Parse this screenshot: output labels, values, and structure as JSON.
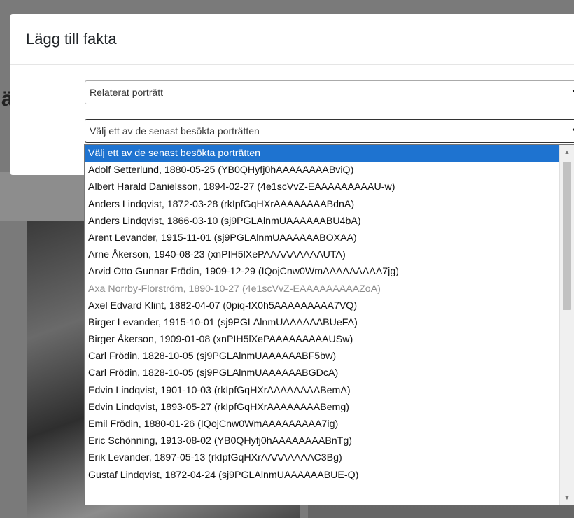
{
  "page": {
    "heading_fragment": "ä"
  },
  "modal": {
    "title": "Lägg till fakta",
    "type_select": {
      "value": "Relaterat porträtt"
    },
    "portrait_select": {
      "value": "Välj ett av de senast besökta porträtten"
    }
  },
  "dropdown": {
    "options": [
      {
        "label": "Välj ett av de senast besökta porträtten",
        "state": "selected"
      },
      {
        "label": "Adolf Setterlund, 1880-05-25 (YB0QHyfj0hAAAAAAAABviQ)",
        "state": "normal"
      },
      {
        "label": "Albert Harald Danielsson, 1894-02-27 (4e1scVvZ-EAAAAAAAAAU-w)",
        "state": "normal"
      },
      {
        "label": "Anders Lindqvist, 1872-03-28 (rkIpfGqHXrAAAAAAAABdnA)",
        "state": "normal"
      },
      {
        "label": "Anders Lindqvist, 1866-03-10 (sj9PGLAlnmUAAAAAABU4bA)",
        "state": "normal"
      },
      {
        "label": "Arent Levander, 1915-11-01 (sj9PGLAlnmUAAAAAABOXAA)",
        "state": "normal"
      },
      {
        "label": "Arne Åkerson, 1940-08-23 (xnPIH5lXePAAAAAAAAAUTA)",
        "state": "normal"
      },
      {
        "label": "Arvid Otto Gunnar Frödin, 1909-12-29 (IQojCnw0WmAAAAAAAAA7jg)",
        "state": "normal"
      },
      {
        "label": "Axa Norrby-Florström, 1890-10-27 (4e1scVvZ-EAAAAAAAAAZoA)",
        "state": "disabled"
      },
      {
        "label": "Axel Edvard Klint, 1882-04-07 (0piq-fX0h5AAAAAAAAA7VQ)",
        "state": "normal"
      },
      {
        "label": "Birger Levander, 1915-10-01 (sj9PGLAlnmUAAAAAABUeFA)",
        "state": "normal"
      },
      {
        "label": "Birger Åkerson, 1909-01-08 (xnPIH5lXePAAAAAAAAAUSw)",
        "state": "normal"
      },
      {
        "label": "Carl Frödin, 1828-10-05 (sj9PGLAlnmUAAAAAABF5bw)",
        "state": "normal"
      },
      {
        "label": "Carl Frödin, 1828-10-05 (sj9PGLAlnmUAAAAAABGDcA)",
        "state": "normal"
      },
      {
        "label": "Edvin Lindqvist, 1901-10-03 (rkIpfGqHXrAAAAAAAABemA)",
        "state": "normal"
      },
      {
        "label": "Edvin Lindqvist, 1893-05-27 (rkIpfGqHXrAAAAAAAABemg)",
        "state": "normal"
      },
      {
        "label": "Emil Frödin, 1880-01-26 (IQojCnw0WmAAAAAAAAA7ig)",
        "state": "normal"
      },
      {
        "label": "Eric Schönning, 1913-08-02 (YB0QHyfj0hAAAAAAAABnTg)",
        "state": "normal"
      },
      {
        "label": "Erik Levander, 1897-05-13 (rkIpfGqHXrAAAAAAAAC3Bg)",
        "state": "normal"
      },
      {
        "label": "Gustaf Lindqvist, 1872-04-24 (sj9PGLAlnmUAAAAAABUE-Q)",
        "state": "normal"
      }
    ]
  },
  "icons": {
    "select_chevron": "chevron-down-icon",
    "scroll_up": "triangle-up-icon",
    "scroll_down": "triangle-down-icon"
  }
}
